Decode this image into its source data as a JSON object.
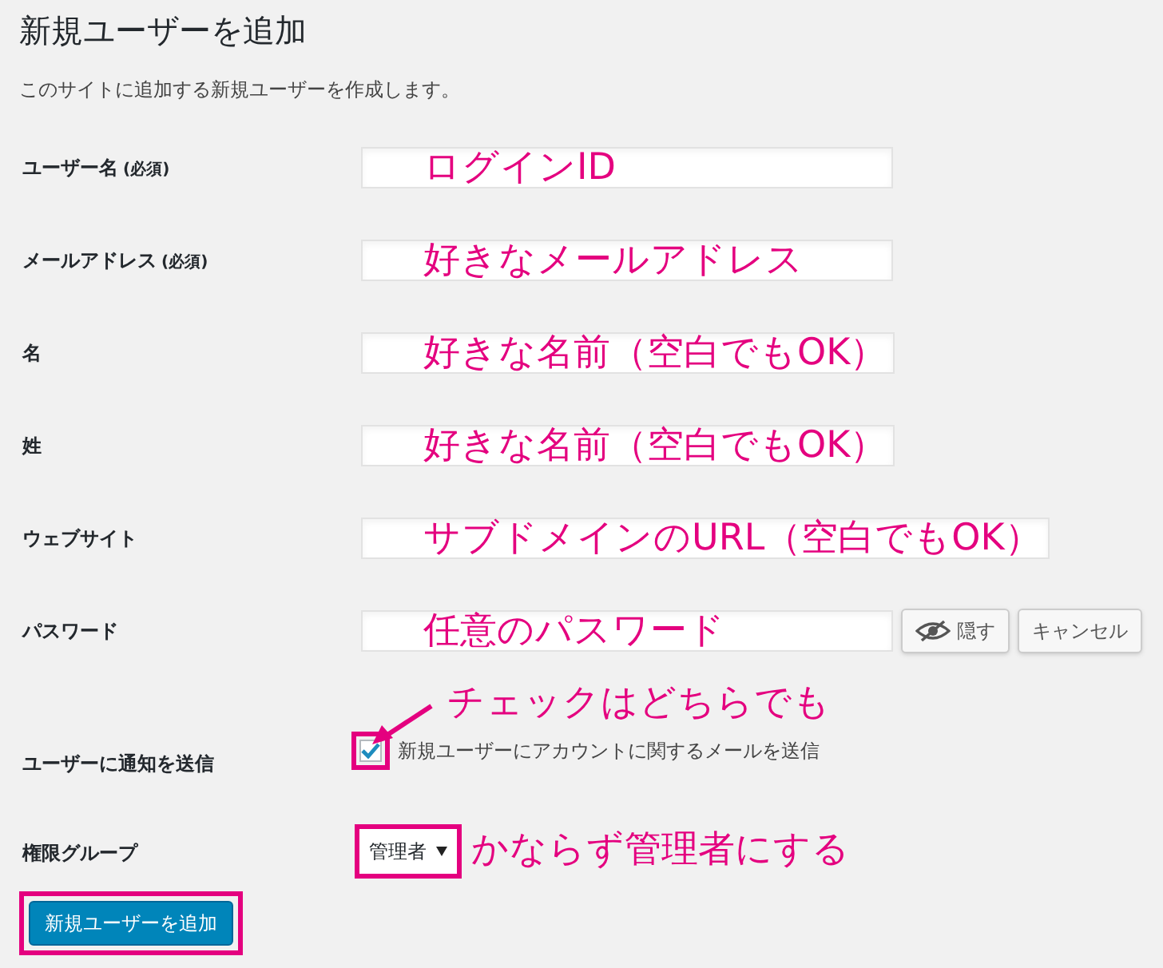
{
  "title": "新規ユーザーを追加",
  "description": "このサイトに追加する新規ユーザーを作成します。",
  "fields": [
    {
      "label": "ユーザー名",
      "required_note": "(必須)",
      "annotation": "ログインID"
    },
    {
      "label": "メールアドレス",
      "required_note": "(必須)",
      "annotation": "好きなメールアドレス"
    },
    {
      "label": "名",
      "annotation": "好きな名前（空白でもOK）"
    },
    {
      "label": "姓",
      "annotation": "好きな名前（空白でもOK）"
    },
    {
      "label": "ウェブサイト",
      "annotation": "サブドメインのURL（空白でもOK）"
    },
    {
      "label": "パスワード",
      "annotation": "任意のパスワード",
      "buttons": [
        "隠す",
        "キャンセル"
      ]
    }
  ],
  "notify": {
    "label": "ユーザーに通知を送信",
    "checked": true,
    "highlighted": true,
    "description": "新規ユーザーにアカウントに関するメールを送信",
    "annotation": "チェックはどちらでも"
  },
  "role": {
    "label": "権限グループ",
    "value": "管理者",
    "highlighted": true,
    "annotation": "かならず管理者にする"
  },
  "submit": {
    "label": "新規ユーザーを追加",
    "highlighted": true
  }
}
